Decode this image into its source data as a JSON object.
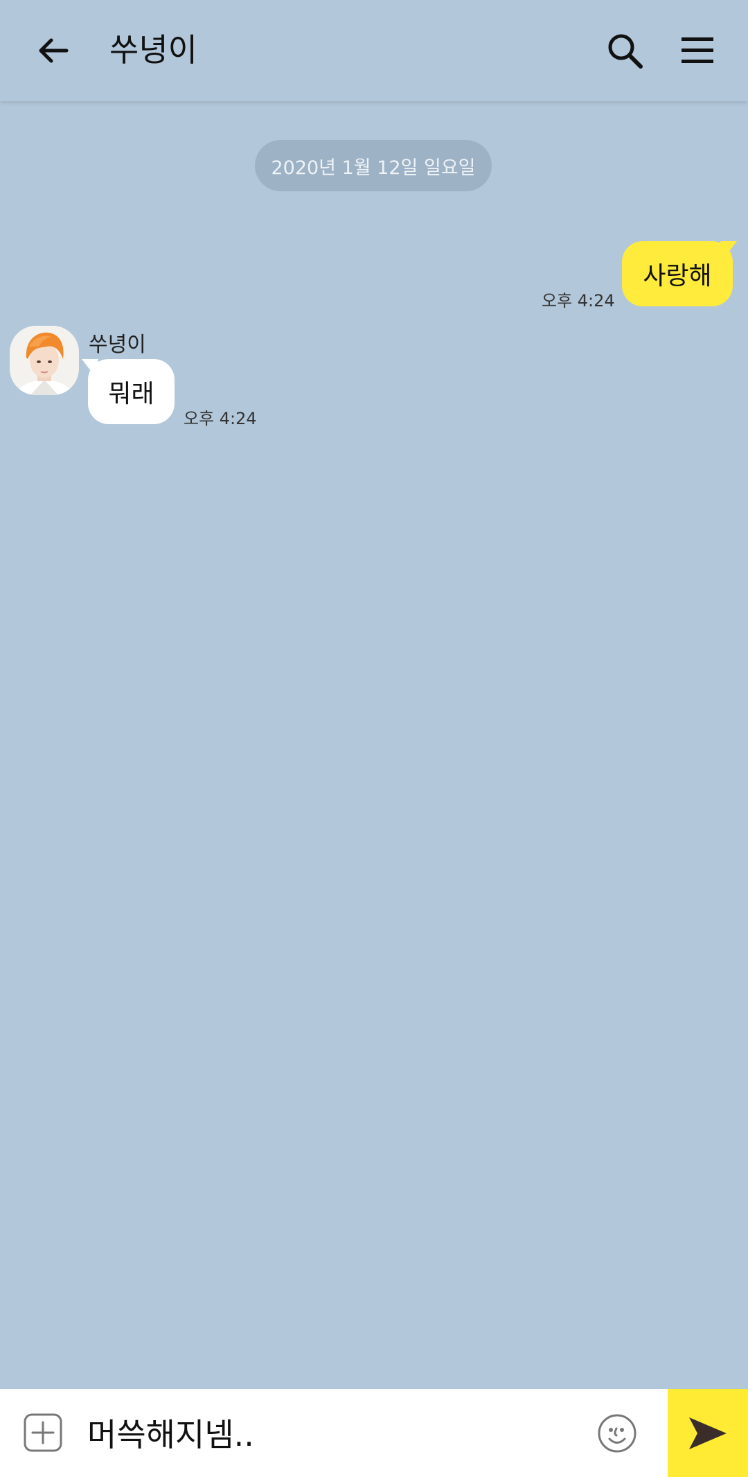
{
  "header": {
    "title": "쑤녕이",
    "back_icon": "arrow-left-icon",
    "search_icon": "search-icon",
    "menu_icon": "hamburger-menu-icon"
  },
  "chat": {
    "date_separator": "2020년 1월 12일 일요일",
    "messages": [
      {
        "direction": "sent",
        "text": "사랑해",
        "time": "오후 4:24"
      },
      {
        "direction": "received",
        "sender": "쑤녕이",
        "text": "뭐래",
        "time": "오후 4:24"
      }
    ]
  },
  "composer": {
    "value": "머쓱해지넴..",
    "plus_icon": "plus-box-icon",
    "emoji_icon": "emoji-icon",
    "send_icon": "send-icon"
  },
  "colors": {
    "chat_background": "#b2c7da",
    "sent_bubble": "#ffeb3b",
    "received_bubble": "#ffffff",
    "send_button": "#ffeb33"
  }
}
